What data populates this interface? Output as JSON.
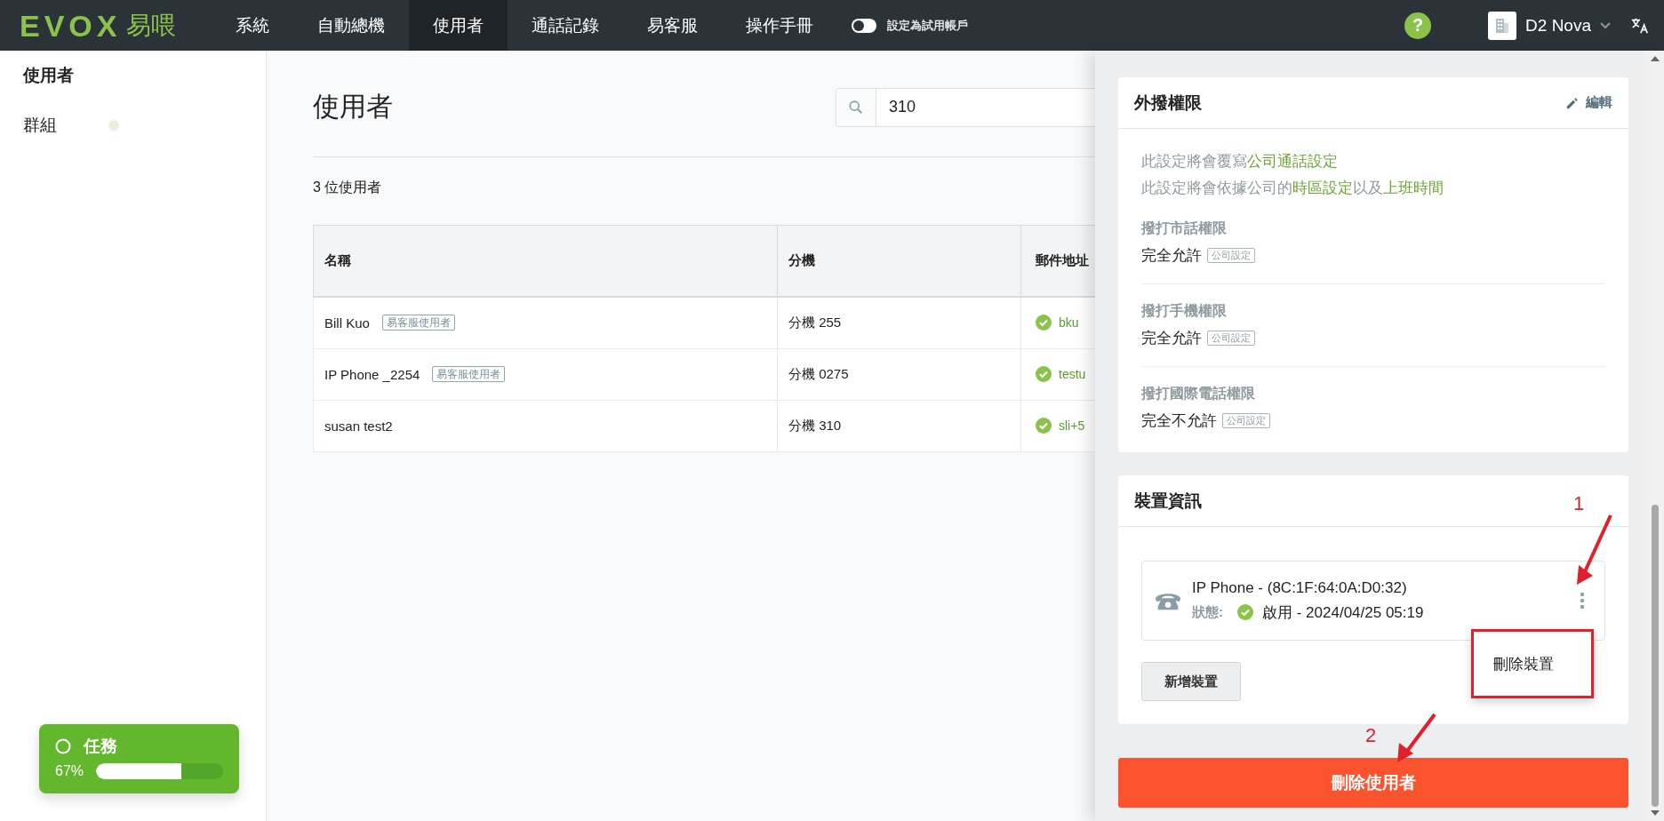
{
  "topbar": {
    "logo": {
      "wordmark": "EVOX",
      "suffix": "易喂"
    },
    "nav": [
      {
        "label": "系統",
        "selected": false
      },
      {
        "label": "自動總機",
        "selected": false
      },
      {
        "label": "使用者",
        "selected": true
      },
      {
        "label": "通話記錄",
        "selected": false
      },
      {
        "label": "易客服",
        "selected": false
      },
      {
        "label": "操作手冊",
        "selected": false
      }
    ],
    "trial_toggle": {
      "label": "設定為試用帳戶",
      "on": false
    },
    "help": "?",
    "account": {
      "name": "D2 Nova"
    }
  },
  "sidebar": {
    "items": [
      {
        "label": "使用者",
        "selected": true
      },
      {
        "label": "群組",
        "selected": false
      }
    ]
  },
  "task_widget": {
    "title": "任務",
    "percent": "67%",
    "level": 0.67
  },
  "users": {
    "title": "使用者",
    "search": {
      "value": "310"
    },
    "count": "3 位使用者",
    "table": {
      "columns": [
        "名稱",
        "分機",
        "郵件地址"
      ],
      "rows": [
        {
          "name": "Bill Kuo",
          "tag": "易客服使用者",
          "extension": "分機 255",
          "email": "bku",
          "verified": true
        },
        {
          "name": "IP Phone _2254",
          "tag": "易客服使用者",
          "extension": "分機 0275",
          "email": "testu",
          "verified": true
        },
        {
          "name": "susan test2",
          "extension": "分機 310",
          "email": "sli+5",
          "verified": true
        }
      ]
    }
  },
  "detail_panel": {
    "outbound": {
      "title": "外撥權限",
      "edit": "編輯",
      "notes": [
        [
          {
            "text": "此設定將會覆寫",
            "link": false
          },
          {
            "text": "公司通話設定",
            "link": true
          }
        ],
        [
          {
            "text": "此設定將會依據公司的",
            "link": false
          },
          {
            "text": "時區設定",
            "link": true
          },
          {
            "text": "以及",
            "link": false
          },
          {
            "text": "上班時間",
            "link": true
          }
        ]
      ],
      "permissions": [
        {
          "label": "撥打市話權限",
          "value": "完全允許",
          "tag": "公司設定"
        },
        {
          "label": "撥打手機權限",
          "value": "完全允許",
          "tag": "公司設定"
        },
        {
          "label": "撥打國際電話權限",
          "value": "完全不允許",
          "tag": "公司設定"
        }
      ]
    },
    "device_info": {
      "title": "裝置資訊",
      "devices": [
        {
          "name": "IP Phone - (8C:1F:64:0A:D0:32)",
          "status_label": "狀態:",
          "enabled": true,
          "status": "啟用 - 2024/04/25 05:19",
          "menu_open": true
        }
      ],
      "menu": {
        "items": [
          "刪除裝置"
        ],
        "highlighted": true
      },
      "add_button": "新增裝置"
    },
    "delete_button": "刪除使用者"
  },
  "annotations": [
    {
      "label": "1"
    },
    {
      "label": "2"
    }
  ]
}
